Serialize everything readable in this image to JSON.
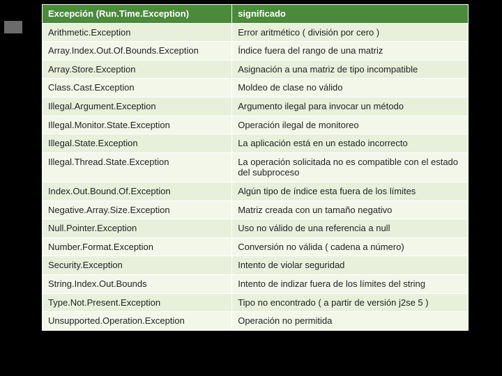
{
  "headers": {
    "col1": "Excepción (Run.Time.Exception)",
    "col2": "significado"
  },
  "rows": [
    {
      "c1": "Arithmetic.Exception",
      "c2": "Error aritmético ( división por cero )"
    },
    {
      "c1": "Array.Index.Out.Of.Bounds.Exception",
      "c2": "Índice fuera del rango de una matriz"
    },
    {
      "c1": "Array.Store.Exception",
      "c2": "Asignación a una matriz de tipo incompatible"
    },
    {
      "c1": "Class.Cast.Exception",
      "c2": "Moldeo de clase no válido"
    },
    {
      "c1": "Illegal.Argument.Exception",
      "c2": "Argumento ilegal para invocar un método"
    },
    {
      "c1": "Illegal.Monitor.State.Exception",
      "c2": "Operación ilegal de monitoreo"
    },
    {
      "c1": "Illegal.State.Exception",
      "c2": "La aplicación está en un estado incorrecto"
    },
    {
      "c1": "Illegal.Thread.State.Exception",
      "c2": "La operación solicitada no es compatible con el estado del subproceso"
    },
    {
      "c1": "Index.Out.Bound.Of.Exception",
      "c2": "Algún tipo de índice esta fuera de los límites"
    },
    {
      "c1": "Negative.Array.Size.Exception",
      "c2": "Matriz creada con un tamaño negativo"
    },
    {
      "c1": "Null.Pointer.Exception",
      "c2": "Uso no válido de una referencia a null"
    },
    {
      "c1": "Number.Format.Exception",
      "c2": "Conversión no válida ( cadena a número)"
    },
    {
      "c1": "Security.Exception",
      "c2": "Intento de violar seguridad"
    },
    {
      "c1": "String.Index.Out.Bounds",
      "c2": "Intento de indizar fuera de los límites del string"
    },
    {
      "c1": "Type.Not.Present.Exception",
      "c2": "Tipo no encontrado ( a partir de versión j2se 5 )"
    },
    {
      "c1": "Unsupported.Operation.Exception",
      "c2": "Operación no permitida"
    }
  ]
}
